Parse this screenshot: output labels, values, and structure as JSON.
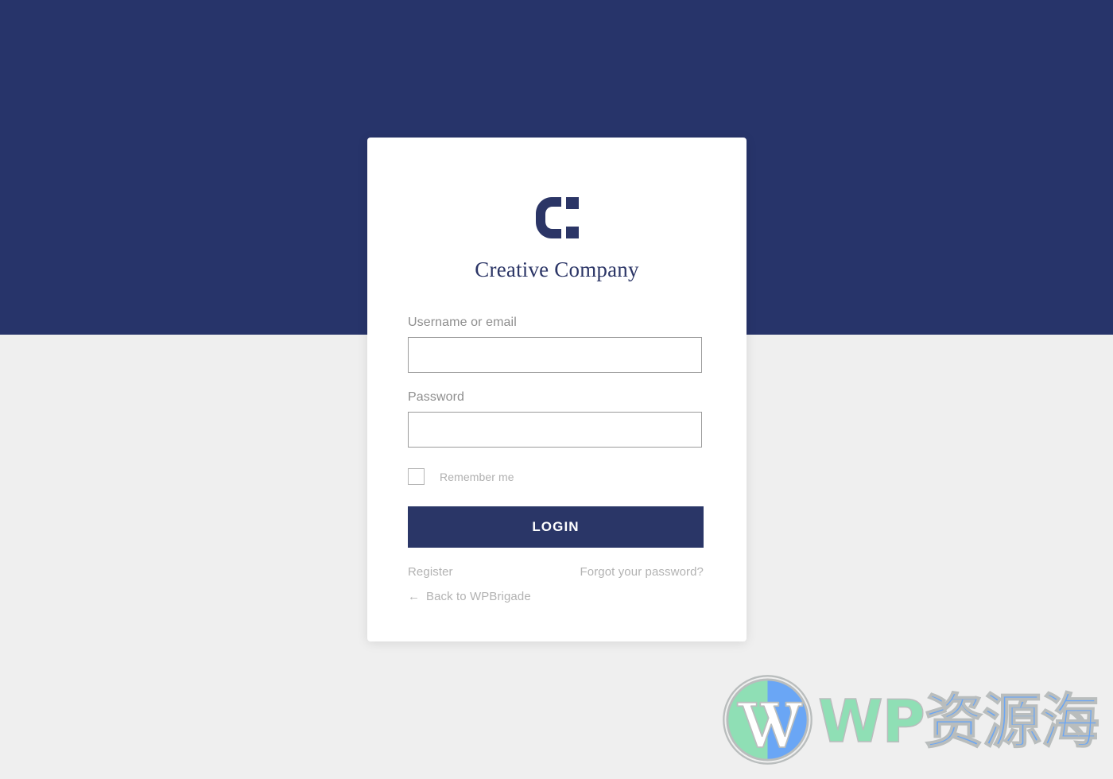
{
  "page": {
    "background_top_color": "#27346a",
    "background_bottom_color": "#efefef"
  },
  "card": {
    "logo_icon": "creative-company-c-logo",
    "brand_name": "Creative Company",
    "brand_color": "#2b3566"
  },
  "form": {
    "username": {
      "label": "Username or email",
      "value": "",
      "placeholder": ""
    },
    "password": {
      "label": "Password",
      "value": "",
      "placeholder": ""
    },
    "remember": {
      "label": "Remember me",
      "checked": false
    },
    "submit_label": "LOGIN",
    "submit_color": "#2a3667"
  },
  "links": {
    "register": "Register",
    "forgot_password": "Forgot your password?",
    "back_arrow_icon": "←",
    "back": "Back to WPBrigade"
  },
  "watermark": {
    "icon": "wordpress-logo",
    "text_latin": "WP",
    "text_cjk": "资源海",
    "green": "#8fdfb5",
    "blue": "#6aa6f5"
  }
}
